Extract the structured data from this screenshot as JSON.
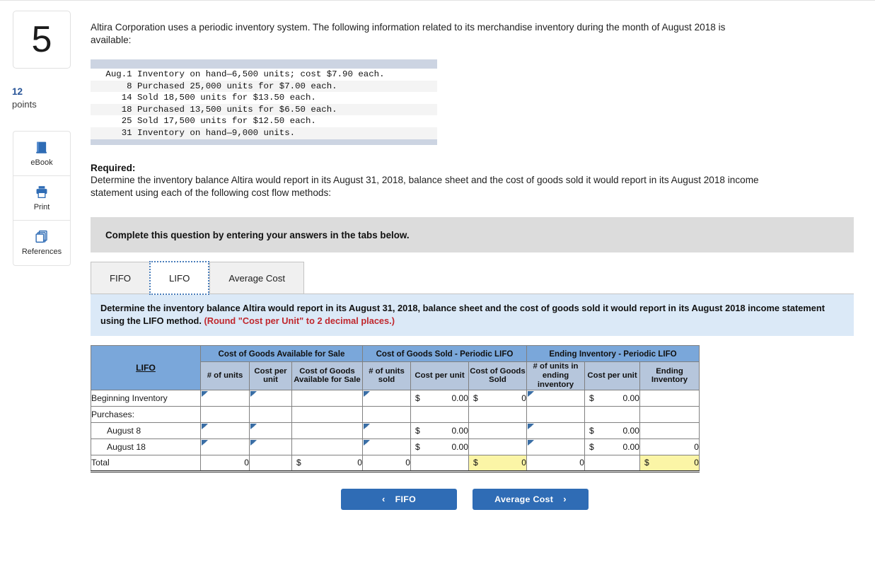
{
  "left_rail": {
    "question_number": "5",
    "points_value": "12",
    "points_label": "points",
    "tools": [
      {
        "icon": "ebook-icon",
        "label": "eBook"
      },
      {
        "icon": "print-icon",
        "label": "Print"
      },
      {
        "icon": "references-icon",
        "label": "References"
      }
    ]
  },
  "intro": {
    "text": "Altira Corporation uses a periodic inventory system. The following information related to its merchandise inventory during the month of August 2018 is available:"
  },
  "inventory_block": {
    "lines": [
      " Aug.1 Inventory on hand—6,500 units; cost $7.90 each.",
      "     8 Purchased 25,000 units for $7.00 each.",
      "    14 Sold 18,500 units for $13.50 each.",
      "    18 Purchased 13,500 units for $6.50 each.",
      "    25 Sold 17,500 units for $12.50 each.",
      "    31 Inventory on hand—9,000 units."
    ]
  },
  "required": {
    "title": "Required:",
    "body": "Determine the inventory balance Altira would report in its August 31, 2018, balance sheet and the cost of goods sold it would report in its August 2018 income statement using each of the following cost flow methods:"
  },
  "complete_banner": {
    "text": "Complete this question by entering your answers in the tabs below."
  },
  "tabs": [
    {
      "label": "FIFO",
      "active": false
    },
    {
      "label": "LIFO",
      "active": true
    },
    {
      "label": "Average Cost",
      "active": false
    }
  ],
  "instruction_panel": {
    "main": "Determine the inventory balance Altira would report in its August 31, 2018, balance sheet and the cost of goods sold it would report in its August 2018 income statement using the LIFO method.",
    "round_note": "(Round \"Cost per Unit\" to 2 decimal places.)"
  },
  "sheet": {
    "corner_label": "LIFO",
    "group_headers": [
      "Cost of Goods Available for Sale",
      "Cost of Goods Sold - Periodic LIFO",
      "Ending Inventory - Periodic LIFO"
    ],
    "sub_headers": [
      "# of units",
      "Cost per unit",
      "Cost of Goods Available for Sale",
      "# of units sold",
      "Cost per unit",
      "Cost of Goods Sold",
      "# of units in ending inventory",
      "Cost per unit",
      "Ending Inventory"
    ],
    "rows": [
      {
        "label": "Beginning Inventory",
        "indent": false,
        "cells": [
          {
            "kind": "input"
          },
          {
            "kind": "input"
          },
          {
            "kind": "blank"
          },
          {
            "kind": "input"
          },
          {
            "kind": "money",
            "currency": "$",
            "value": "0.00"
          },
          {
            "kind": "money",
            "currency": "$",
            "value": "0"
          },
          {
            "kind": "input"
          },
          {
            "kind": "money",
            "currency": "$",
            "value": "0.00"
          },
          {
            "kind": "blank"
          }
        ]
      },
      {
        "label": "Purchases:",
        "indent": false,
        "cells": [
          {
            "kind": "blank"
          },
          {
            "kind": "blank"
          },
          {
            "kind": "blank"
          },
          {
            "kind": "blank"
          },
          {
            "kind": "blank"
          },
          {
            "kind": "blank"
          },
          {
            "kind": "blank"
          },
          {
            "kind": "blank"
          },
          {
            "kind": "blank"
          }
        ]
      },
      {
        "label": "August 8",
        "indent": true,
        "cells": [
          {
            "kind": "input"
          },
          {
            "kind": "input"
          },
          {
            "kind": "blank"
          },
          {
            "kind": "input"
          },
          {
            "kind": "money",
            "currency": "$",
            "value": "0.00"
          },
          {
            "kind": "blank"
          },
          {
            "kind": "input"
          },
          {
            "kind": "money",
            "currency": "$",
            "value": "0.00"
          },
          {
            "kind": "blank"
          }
        ]
      },
      {
        "label": "August 18",
        "indent": true,
        "cells": [
          {
            "kind": "input"
          },
          {
            "kind": "input"
          },
          {
            "kind": "blank"
          },
          {
            "kind": "input"
          },
          {
            "kind": "money",
            "currency": "$",
            "value": "0.00"
          },
          {
            "kind": "blank"
          },
          {
            "kind": "input"
          },
          {
            "kind": "money",
            "currency": "$",
            "value": "0.00"
          },
          {
            "kind": "num",
            "value": "0"
          }
        ]
      },
      {
        "label": "Total",
        "indent": false,
        "total": true,
        "cells": [
          {
            "kind": "num",
            "value": "0"
          },
          {
            "kind": "blank"
          },
          {
            "kind": "money",
            "currency": "$",
            "value": "0"
          },
          {
            "kind": "num",
            "value": "0"
          },
          {
            "kind": "blank"
          },
          {
            "kind": "money",
            "currency": "$",
            "value": "0",
            "highlight": true
          },
          {
            "kind": "num",
            "value": "0"
          },
          {
            "kind": "blank"
          },
          {
            "kind": "money",
            "currency": "$",
            "value": "0",
            "highlight": true
          }
        ]
      }
    ]
  },
  "nav": {
    "prev_label": "FIFO",
    "prev_chevron": "‹",
    "next_label": "Average Cost",
    "next_chevron": "›"
  },
  "colors": {
    "accent_blue": "#2f6cb5",
    "header_blue": "#7aa7da",
    "subheader_blue": "#b6c6dc",
    "panel_blue": "#dbe9f7",
    "highlight_yellow": "#fbf5a6",
    "note_red": "#c0272d"
  }
}
